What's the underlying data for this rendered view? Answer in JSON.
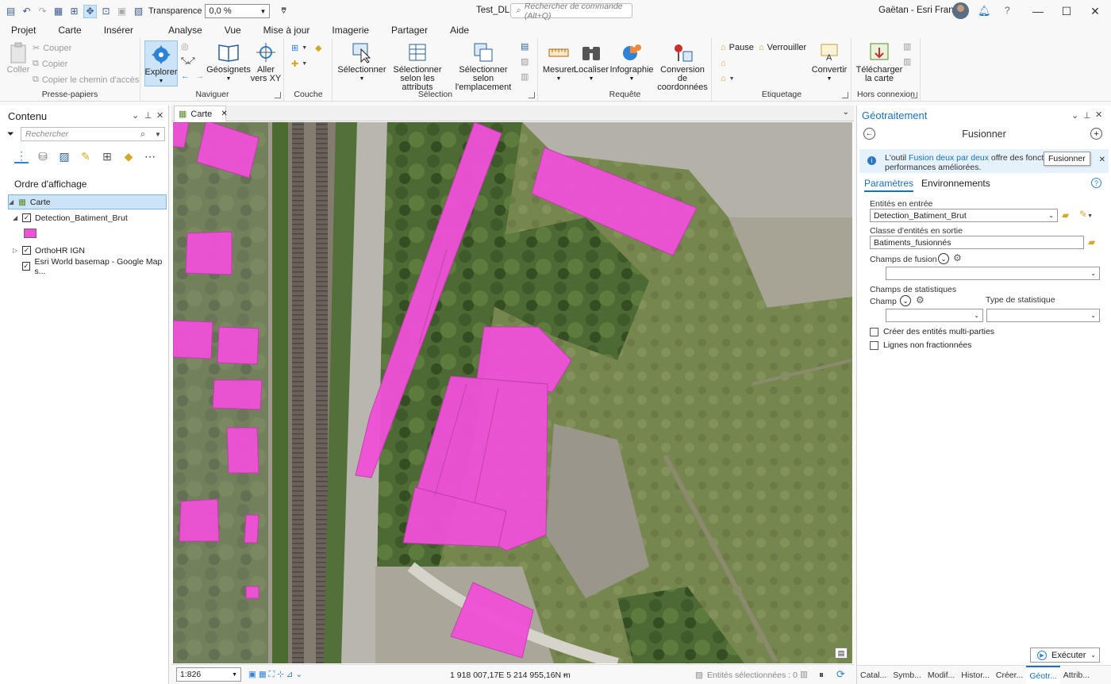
{
  "titlebar": {
    "transparency_label": "Transparence",
    "transparency_value": "0,0 %",
    "project_name": "Test_DL",
    "command_search_placeholder": "Rechercher de commande (Alt+Q)",
    "user_name": "Gaëtan - Esri France"
  },
  "ribbon_tabs": [
    "Projet",
    "Carte",
    "Insérer",
    "Analyse",
    "Vue",
    "Mise à jour",
    "Imagerie",
    "Partager",
    "Aide"
  ],
  "ribbon": {
    "clipboard": {
      "paste": "Coller",
      "cut": "Couper",
      "copy": "Copier",
      "copy_path": "Copier le chemin d'accès",
      "group": "Presse-papiers"
    },
    "navigate": {
      "explore": "Explorer",
      "bookmarks": "Géosignets",
      "goto_xy_1": "Aller",
      "goto_xy_2": "vers XY",
      "group": "Naviguer"
    },
    "layer": {
      "group": "Couche"
    },
    "selection": {
      "select": "Sélectionner",
      "by_attr_1": "Sélectionner",
      "by_attr_2": "selon les attributs",
      "by_loc_1": "Sélectionner selon",
      "by_loc_2": "l'emplacement",
      "group": "Sélection"
    },
    "inquiry": {
      "measure": "Mesurer",
      "locate": "Localiser",
      "infographics": "Infographie",
      "coord_1": "Conversion de",
      "coord_2": "coordonnées",
      "group": "Requête"
    },
    "labeling": {
      "pause": "Pause",
      "lock": "Verrouiller",
      "convert": "Convertir",
      "group": "Etiquetage"
    },
    "offline": {
      "download_1": "Télécharger",
      "download_2": "la carte",
      "group": "Hors connexion"
    }
  },
  "contents": {
    "title": "Contenu",
    "search_placeholder": "Rechercher",
    "drawing_order": "Ordre d'affichage",
    "layers": [
      {
        "name": "Carte"
      },
      {
        "name": "Detection_Batiment_Brut",
        "checked": true
      },
      {
        "name": "OrthoHR IGN",
        "checked": true
      },
      {
        "name": "Esri World basemap - Google Map s...",
        "checked": true
      }
    ],
    "symbol_color": "#f050d8"
  },
  "map": {
    "tab_label": "Carte",
    "scale": "1:826",
    "coordinates": "1 918 007,17E 5 214 955,16N m",
    "selected_features": "Entités sélectionnées : 0"
  },
  "geoprocessing": {
    "title": "Géotraitement",
    "tool_name": "Fusionner",
    "info_prefix": "L'outil ",
    "info_link": "Fusion deux par deux",
    "info_suffix": " offre des fonctio",
    "info_line2": "performances améliorées.",
    "tooltip": "Fusionner",
    "tabs": [
      "Paramètres",
      "Environnements"
    ],
    "input_label": "Entités en entrée",
    "input_value": "Detection_Batiment_Brut",
    "output_label": "Classe d'entités en sortie",
    "output_value": "Batiments_fusionnés",
    "dissolve_label": "Champs de fusion",
    "stats_label": "Champs de statistiques",
    "field_label": "Champ",
    "stat_type_label": "Type de statistique",
    "multipart_label": "Créer des entités multi-parties",
    "unsplit_label": "Lignes non fractionnées",
    "run_label": "Exécuter",
    "bottom_tabs": [
      "Catal...",
      "Symb...",
      "Modif...",
      "Histor...",
      "Créer...",
      "Géotr...",
      "Attrib..."
    ]
  }
}
